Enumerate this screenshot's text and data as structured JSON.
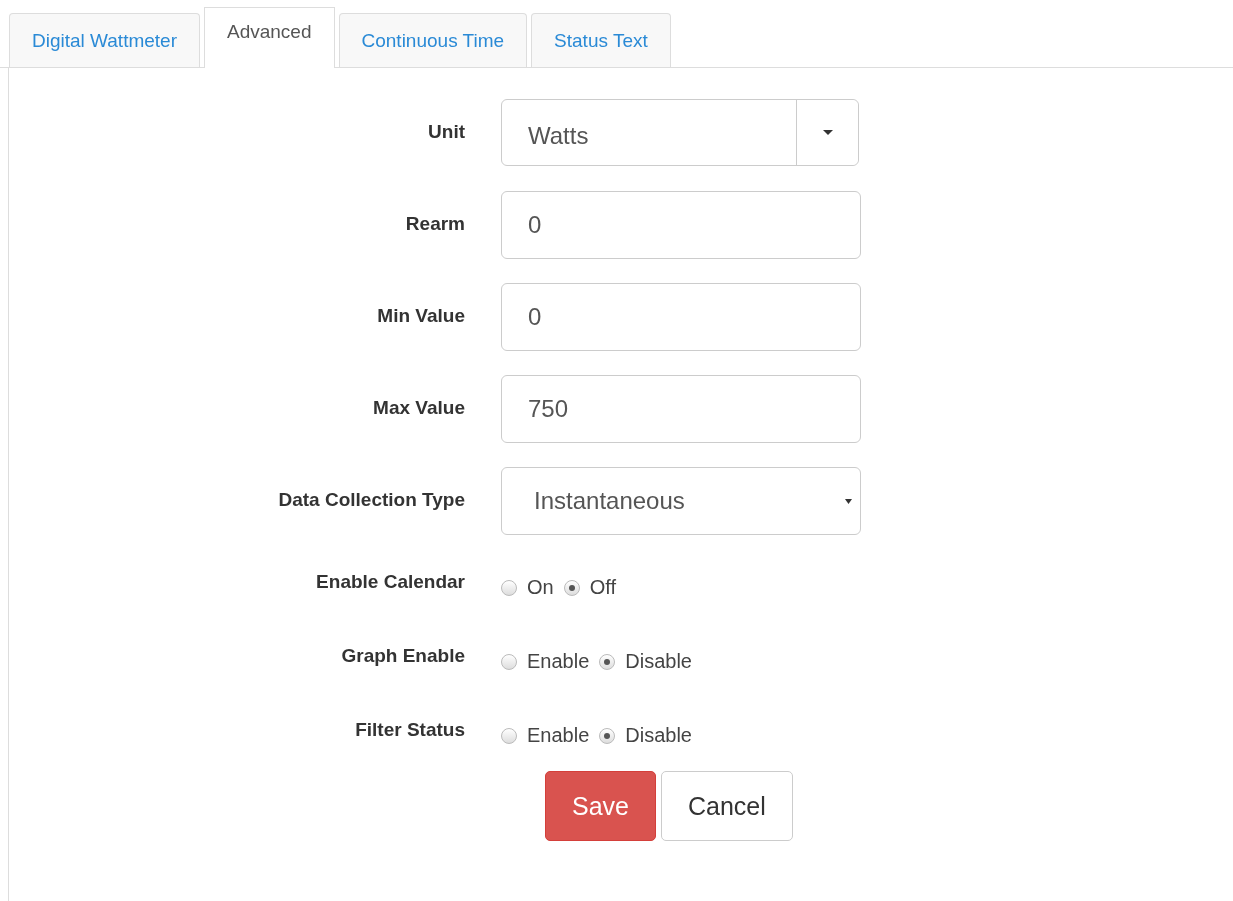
{
  "tabs": [
    {
      "label": "Digital Wattmeter",
      "selected": false
    },
    {
      "label": "Advanced",
      "selected": true
    },
    {
      "label": "Continuous Time",
      "selected": false
    },
    {
      "label": "Status Text",
      "selected": false
    }
  ],
  "fields": [
    {
      "kind": "dropdown",
      "label": "Unit",
      "value": "Watts"
    },
    {
      "kind": "text",
      "label": "Rearm",
      "value": "0"
    },
    {
      "kind": "text",
      "label": "Min Value",
      "value": "0"
    },
    {
      "kind": "text",
      "label": "Max Value",
      "value": "750"
    },
    {
      "kind": "select",
      "label": "Data Collection Type",
      "value": "Instantaneous"
    },
    {
      "kind": "radio",
      "label": "Enable Calendar",
      "options": [
        {
          "label": "On",
          "selected": false
        },
        {
          "label": "Off",
          "selected": true
        }
      ]
    },
    {
      "kind": "radio",
      "label": "Graph Enable",
      "options": [
        {
          "label": "Enable",
          "selected": false
        },
        {
          "label": "Disable",
          "selected": true
        }
      ]
    },
    {
      "kind": "radio",
      "label": "Filter Status",
      "options": [
        {
          "label": "Enable",
          "selected": false
        },
        {
          "label": "Disable",
          "selected": true
        }
      ]
    }
  ],
  "buttons": [
    {
      "kind": "primary",
      "label": "Save"
    },
    {
      "kind": "default",
      "label": "Cancel"
    }
  ]
}
